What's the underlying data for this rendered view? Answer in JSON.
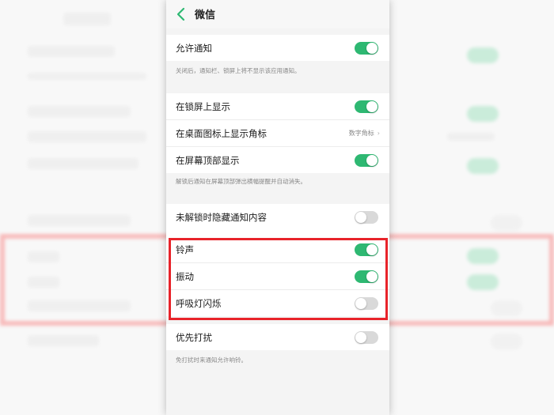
{
  "header": {
    "title": "微信",
    "back_icon": "chevron-left-icon"
  },
  "groups": [
    {
      "rows": [
        {
          "label": "允许通知",
          "control": "toggle",
          "on": true
        }
      ],
      "note": "关闭后，通知栏、锁屏上将不显示该应用通知。"
    },
    {
      "rows": [
        {
          "label": "在锁屏上显示",
          "control": "toggle",
          "on": true
        },
        {
          "label": "在桌面图标上显示角标",
          "control": "value",
          "value": "数字角标"
        },
        {
          "label": "在屏幕顶部显示",
          "control": "toggle",
          "on": true
        }
      ],
      "note": "解锁后通知在屏幕顶部弹出横幅提醒并自动消失。"
    },
    {
      "rows": [
        {
          "label": "未解锁时隐藏通知内容",
          "control": "toggle",
          "on": false
        },
        {
          "label": "铃声",
          "control": "toggle",
          "on": true
        },
        {
          "label": "振动",
          "control": "toggle",
          "on": true
        },
        {
          "label": "呼吸灯闪烁",
          "control": "toggle",
          "on": false
        }
      ]
    },
    {
      "rows": [
        {
          "label": "优先打扰",
          "control": "toggle",
          "on": false
        }
      ],
      "note": "免打扰时来通知允许响铃。"
    }
  ],
  "colors": {
    "toggle_on": "#2eb872",
    "toggle_off": "#d9d9d9",
    "highlight": "#e8232a"
  }
}
